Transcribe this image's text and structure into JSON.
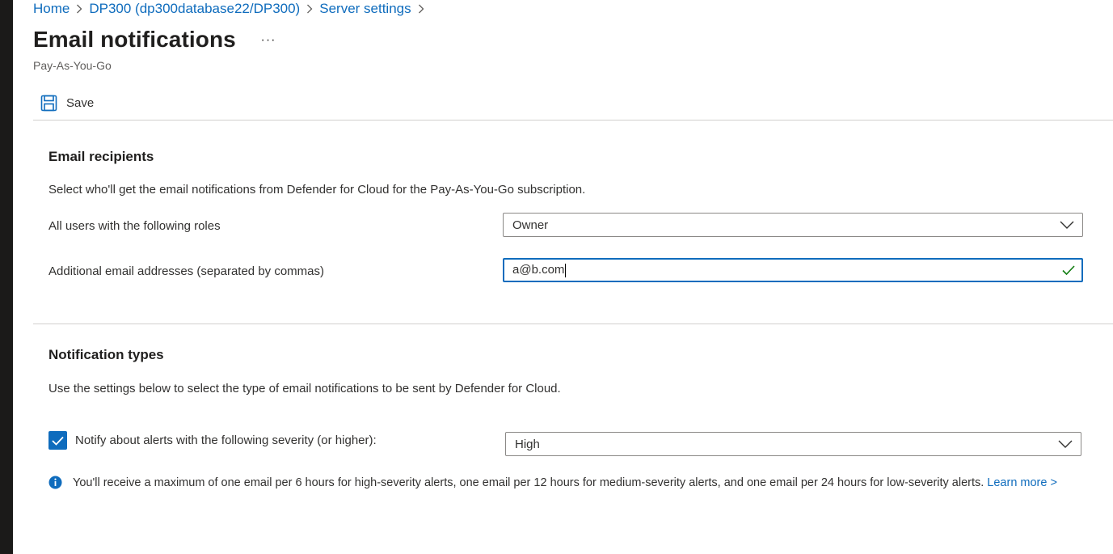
{
  "breadcrumb": {
    "items": [
      "Home",
      "DP300 (dp300database22/DP300)",
      "Server settings"
    ]
  },
  "page": {
    "title": "Email notifications",
    "more_label": "···",
    "subtitle": "Pay-As-You-Go"
  },
  "toolbar": {
    "save_label": "Save"
  },
  "recipients": {
    "heading": "Email recipients",
    "description": "Select who'll get the email notifications from Defender for Cloud for the Pay-As-You-Go subscription.",
    "roles_label": "All users with the following roles",
    "roles_value": "Owner",
    "emails_label": "Additional email addresses (separated by commas)",
    "emails_value": "a@b.com"
  },
  "notification_types": {
    "heading": "Notification types",
    "description": "Use the settings below to select the type of email notifications to be sent by Defender for Cloud.",
    "severity_checked": true,
    "severity_label": "Notify about alerts with the following severity (or higher):",
    "severity_value": "High",
    "info_text": "You'll receive a maximum of one email per 6 hours for high-severity alerts, one email per 12 hours for medium-severity alerts, and one email per 24 hours for low-severity alerts.",
    "learn_more": "Learn more >"
  },
  "colors": {
    "accent": "#0f6cbd",
    "success": "#107c10",
    "text": "#323130"
  },
  "icons": {
    "breadcrumb_separator": "chevron-right-icon",
    "save": "save-icon",
    "dropdown": "chevron-down-icon",
    "valid": "checkmark-icon",
    "info": "info-icon"
  }
}
